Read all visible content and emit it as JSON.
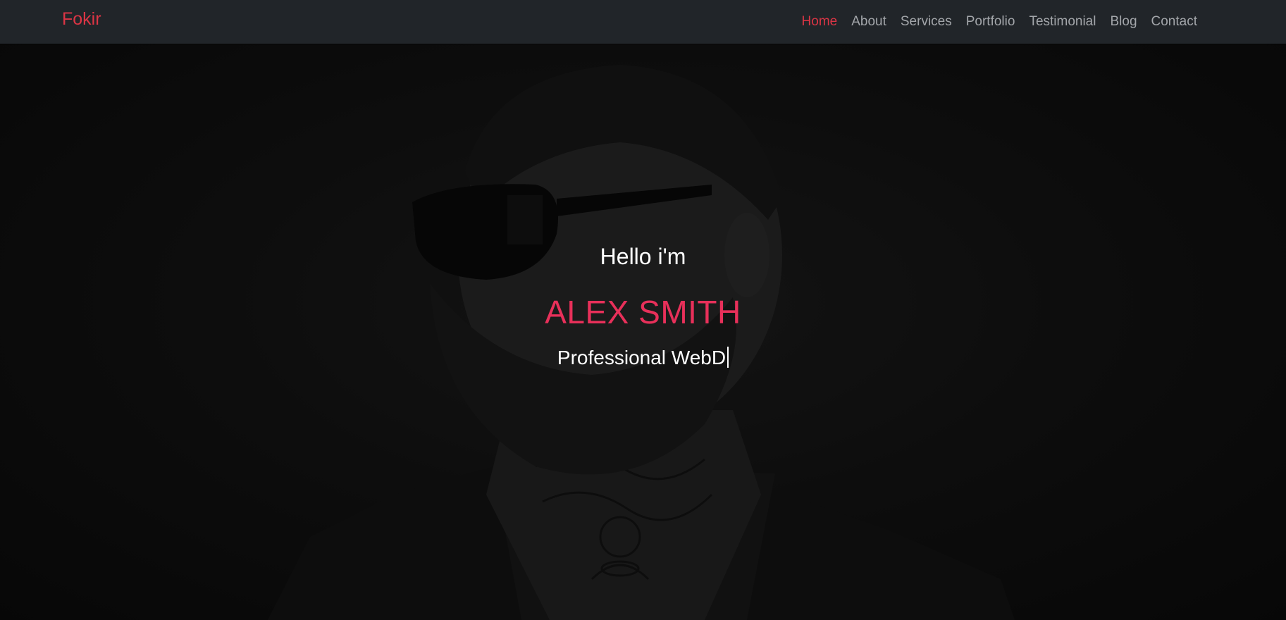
{
  "brand": {
    "name": "Fokir",
    "color": "#dc3545"
  },
  "nav": {
    "items": [
      {
        "label": "Home",
        "active": true
      },
      {
        "label": "About",
        "active": false
      },
      {
        "label": "Services",
        "active": false
      },
      {
        "label": "Portfolio",
        "active": false
      },
      {
        "label": "Testimonial",
        "active": false
      },
      {
        "label": "Blog",
        "active": false
      },
      {
        "label": "Contact",
        "active": false
      }
    ]
  },
  "hero": {
    "greeting": "Hello i'm",
    "name": "ALEX SMITH",
    "role_typed": "Professional WebD",
    "name_color": "#e8305a",
    "background": "dark photo of bearded man with sunglasses and neck tattoos"
  }
}
